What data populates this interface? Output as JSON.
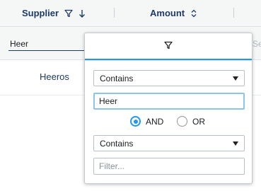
{
  "header": {
    "columns": [
      {
        "label": "Supplier",
        "filter_active": true,
        "sort": "descending"
      },
      {
        "label": "Amount",
        "filter_active": false,
        "sort": "none"
      }
    ]
  },
  "floating_filter": {
    "supplier_value": "Heer",
    "truncated_text": "Se"
  },
  "rows": [
    {
      "supplier": "Heeros"
    }
  ],
  "filter_popup": {
    "tab_icon": "filter-icon",
    "condition1": {
      "type": "Contains",
      "value": "Heer"
    },
    "join_options": [
      {
        "label": "AND",
        "checked": true
      },
      {
        "label": "OR",
        "checked": false
      }
    ],
    "condition2": {
      "type": "Contains",
      "value": "",
      "placeholder": "Filter..."
    }
  },
  "colors": {
    "accent": "#2196f3",
    "header_text": "#1e3a66"
  }
}
